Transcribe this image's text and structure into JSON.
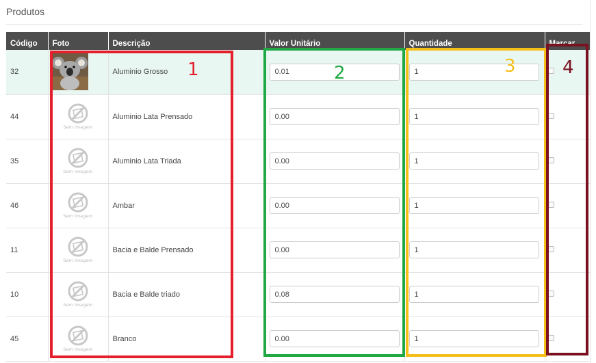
{
  "panel": {
    "title": "Produtos"
  },
  "table": {
    "headers": {
      "codigo": "Código",
      "foto": "Foto",
      "descricao": "Descrição",
      "valor": "Valor Unitário",
      "quantidade": "Quantidade",
      "marcar": "Marcar"
    },
    "no_image_text": "Sem Imagem",
    "rows": [
      {
        "codigo": "32",
        "descricao": "Aluminio Grosso",
        "valor": "0.01",
        "quantidade": "1",
        "photo": "koala-photo",
        "marcar": false
      },
      {
        "codigo": "44",
        "descricao": "Aluminio Lata Prensado",
        "valor": "0.00",
        "quantidade": "1",
        "photo": "no-image-icon",
        "marcar": false
      },
      {
        "codigo": "35",
        "descricao": "Aluminio Lata Triada",
        "valor": "0.00",
        "quantidade": "1",
        "photo": "no-image-icon",
        "marcar": false
      },
      {
        "codigo": "46",
        "descricao": "Ambar",
        "valor": "0.00",
        "quantidade": "1",
        "photo": "no-image-icon",
        "marcar": false
      },
      {
        "codigo": "11",
        "descricao": "Bacia e Balde Prensado",
        "valor": "0.00",
        "quantidade": "1",
        "photo": "no-image-icon",
        "marcar": false
      },
      {
        "codigo": "10",
        "descricao": "Bacia e Balde triado",
        "valor": "0.08",
        "quantidade": "1",
        "photo": "no-image-icon",
        "marcar": false
      },
      {
        "codigo": "45",
        "descricao": "Branco",
        "valor": "0.00",
        "quantidade": "1",
        "photo": "no-image-icon",
        "marcar": false
      }
    ]
  },
  "annotations": [
    {
      "label": "1",
      "color": "#e3202b"
    },
    {
      "label": "2",
      "color": "#1fa843"
    },
    {
      "label": "3",
      "color": "#f5bf1a"
    },
    {
      "label": "4",
      "color": "#7a1020"
    }
  ],
  "colors": {
    "header_bg": "#4d4d4d",
    "highlight_row": "#e8f7f2"
  }
}
